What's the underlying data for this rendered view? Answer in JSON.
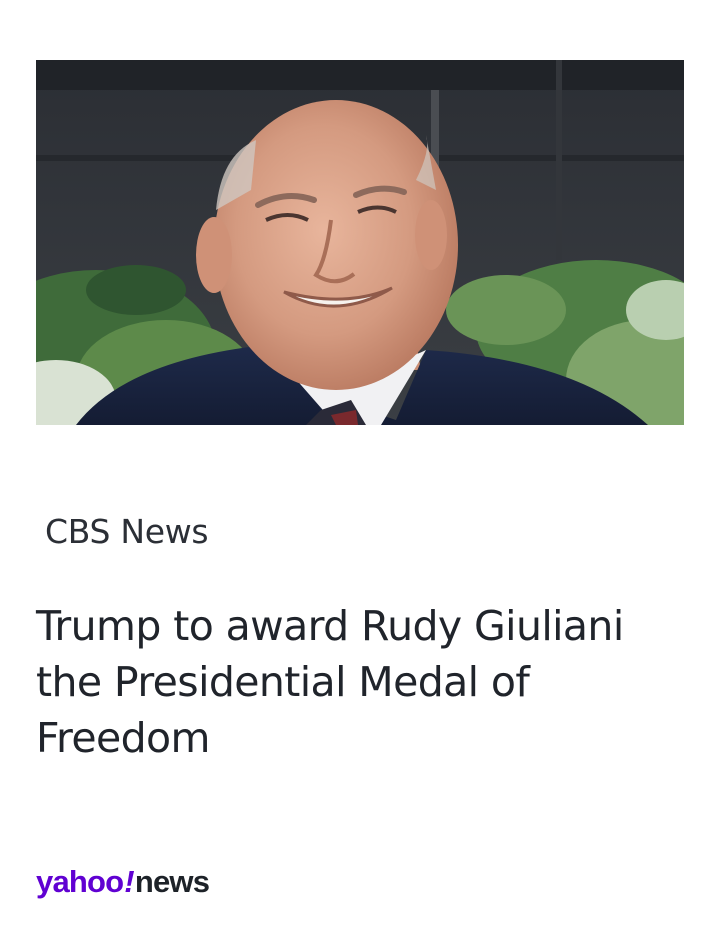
{
  "article": {
    "image_alt": "Rudy Giuliani smiling outdoors in a dark suit",
    "source": "CBS News",
    "headline": "Trump to award Rudy Giuliani the Presidential Medal of Freedom"
  },
  "brand": {
    "yahoo": "yahoo",
    "bang": "!",
    "news": "news",
    "colors": {
      "yahoo_purple": "#6001d2",
      "news_dark": "#1d2228"
    }
  }
}
